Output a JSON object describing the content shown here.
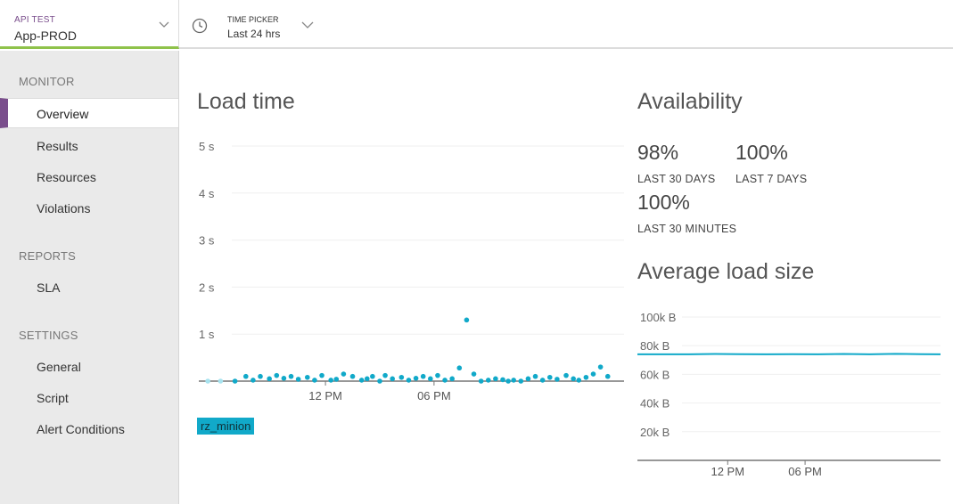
{
  "header": {
    "app_selector": {
      "label": "API TEST",
      "value": "App-PROD"
    },
    "time_picker": {
      "label": "TIME PICKER",
      "value": "Last 24 hrs"
    }
  },
  "sidebar": {
    "sections": [
      {
        "title": "MONITOR",
        "items": [
          "Overview",
          "Results",
          "Resources",
          "Violations"
        ]
      },
      {
        "title": "REPORTS",
        "items": [
          "SLA"
        ]
      },
      {
        "title": "SETTINGS",
        "items": [
          "General",
          "Script",
          "Alert Conditions"
        ]
      }
    ],
    "active_item": "Overview",
    "accent_color": "#7a4e8c"
  },
  "load_time": {
    "title": "Load time",
    "legend": "rz_minion",
    "series_color": "#11a9c9"
  },
  "availability": {
    "title": "Availability",
    "stats": [
      {
        "value": "98%",
        "label": "LAST 30 DAYS"
      },
      {
        "value": "100%",
        "label": "LAST 7 DAYS"
      },
      {
        "value": "100%",
        "label": "LAST 30 MINUTES"
      }
    ]
  },
  "avg_load_size": {
    "title": "Average load size"
  },
  "chart_data": [
    {
      "type": "scatter",
      "title": "Load time",
      "y_ticks": [
        "5 s",
        "4 s",
        "3 s",
        "2 s",
        "1 s"
      ],
      "ylim": [
        0,
        5
      ],
      "y_unit": "s",
      "x_ticks": [
        "12 PM",
        "06 PM"
      ],
      "series": [
        {
          "name": "rz_minion",
          "color": "#11a9c9",
          "x": [
            0.5,
            1.2,
            2.0,
            2.6,
            3.0,
            3.4,
            3.9,
            4.3,
            4.7,
            5.1,
            5.5,
            6.0,
            6.4,
            6.8,
            7.3,
            7.6,
            8.0,
            8.5,
            9.0,
            9.3,
            9.6,
            10.0,
            10.3,
            10.7,
            11.2,
            11.6,
            12.0,
            12.4,
            12.8,
            13.2,
            13.6,
            14.0,
            14.4,
            14.8,
            15.2,
            15.6,
            16.0,
            16.4,
            16.8,
            17.1,
            17.4,
            17.8,
            18.2,
            18.6,
            19.0,
            19.4,
            19.8,
            20.3,
            20.7,
            21.0,
            21.4,
            21.8,
            22.2,
            22.6
          ],
          "y": [
            0.0,
            0.0,
            0.0,
            0.1,
            0.02,
            0.1,
            0.05,
            0.12,
            0.06,
            0.1,
            0.04,
            0.08,
            0.02,
            0.12,
            0.02,
            0.04,
            0.15,
            0.1,
            0.02,
            0.05,
            0.1,
            0.0,
            0.12,
            0.05,
            0.08,
            0.02,
            0.06,
            0.1,
            0.05,
            0.12,
            0.02,
            0.05,
            0.28,
            1.3,
            0.15,
            0.0,
            0.02,
            0.05,
            0.03,
            0.0,
            0.02,
            0.0,
            0.05,
            0.1,
            0.02,
            0.08,
            0.04,
            0.12,
            0.05,
            0.02,
            0.08,
            0.15,
            0.3,
            0.1
          ]
        }
      ],
      "x_range_hours": [
        0,
        23.5
      ],
      "x_tick_hours": [
        7.0,
        13.0
      ]
    },
    {
      "type": "line",
      "title": "Average load size",
      "y_ticks": [
        "100k B",
        "80k B",
        "60k B",
        "40k B",
        "20k B"
      ],
      "ylim": [
        0,
        100000
      ],
      "x_ticks": [
        "12 PM",
        "06 PM"
      ],
      "series": [
        {
          "color": "#11a9c9",
          "x": [
            0,
            2,
            4,
            6,
            8,
            10,
            12,
            14,
            16,
            18,
            20,
            22,
            23.5
          ],
          "y": [
            74000,
            74000,
            74000,
            74200,
            74100,
            74000,
            74100,
            74000,
            74200,
            74000,
            74300,
            74100,
            74000
          ]
        }
      ],
      "x_range_hours": [
        0,
        23.5
      ],
      "x_tick_hours": [
        7.0,
        13.0
      ]
    }
  ]
}
